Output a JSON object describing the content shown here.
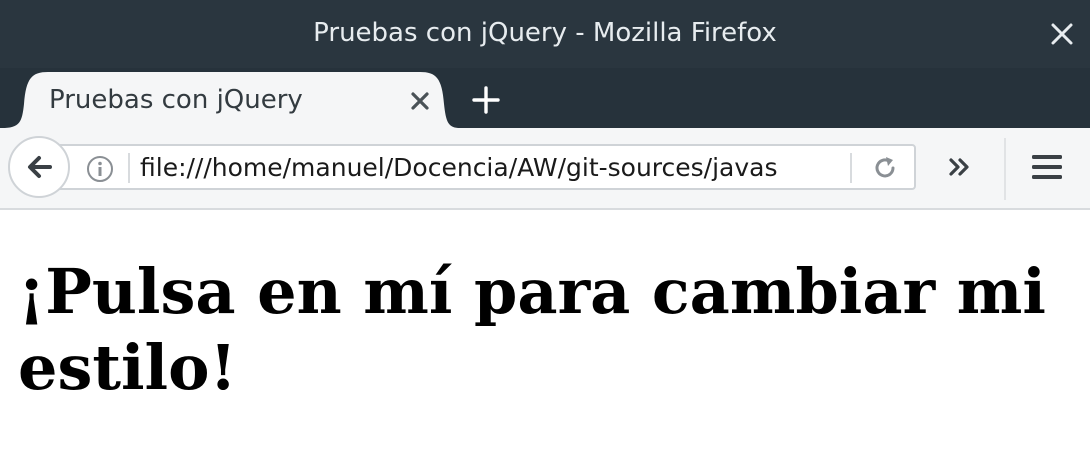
{
  "window": {
    "title": "Pruebas con jQuery - Mozilla Firefox"
  },
  "tabs": [
    {
      "label": "Pruebas con jQuery",
      "active": true
    }
  ],
  "navbar": {
    "url": "file:///home/manuel/Docencia/AW/git-sources/javas"
  },
  "page": {
    "heading": "¡Pulsa en mí para cambiar mi estilo!"
  },
  "icons": {
    "window_close": "close-icon",
    "tab_close": "close-icon",
    "new_tab": "plus-icon",
    "back": "back-arrow-icon",
    "site_info": "info-icon",
    "reload": "reload-icon",
    "overflow": "chevron-double-right-icon",
    "menu": "hamburger-menu-icon"
  },
  "colors": {
    "titlebar": "#2a363f",
    "tabstrip": "#26323b",
    "active_tab": "#f5f6f7",
    "navbar": "#f5f6f7"
  }
}
